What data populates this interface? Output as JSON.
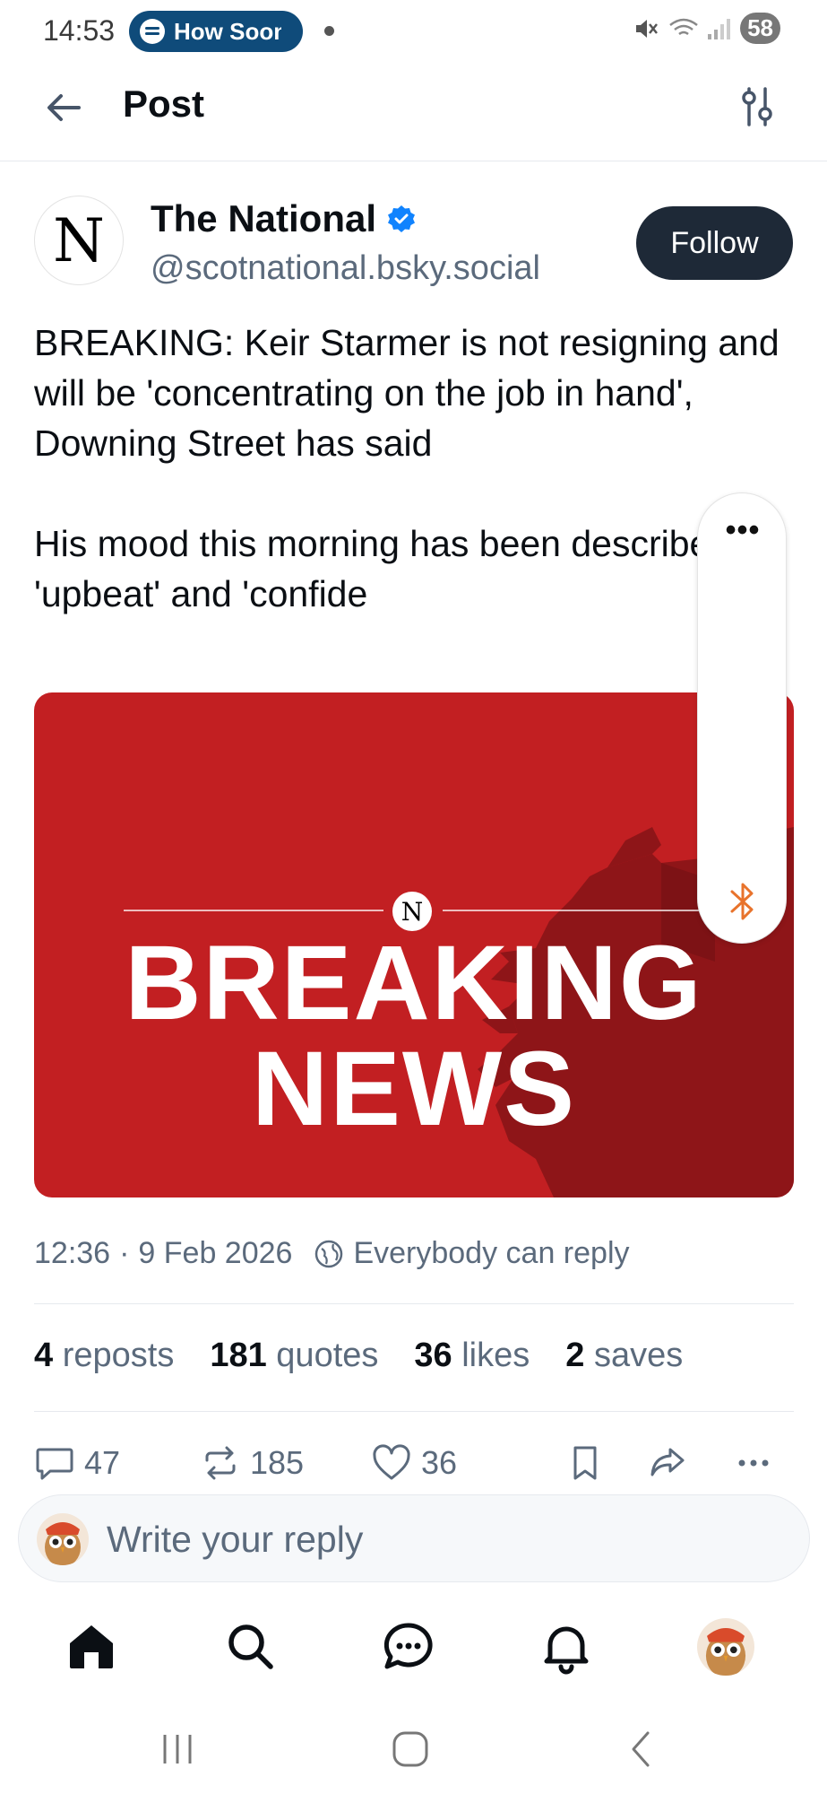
{
  "status_bar": {
    "time": "14:53",
    "now_playing": "How Soon",
    "battery": "58"
  },
  "header": {
    "title": "Post"
  },
  "post": {
    "author_name": "The National",
    "author_logo": "N",
    "handle": "@scotnational.bsky.social",
    "follow_label": "Follow",
    "body": "BREAKING: Keir Starmer is not resigning and will be 'concentrating on the job in hand', Downing Street has said\n\nHis mood this morning has been described as 'upbeat' and 'confide",
    "image": {
      "logo": "N",
      "line1": "BREAKING",
      "line2": "NEWS",
      "bg_color": "#c21f22"
    },
    "timestamp": "12:36",
    "date": "9 Feb 2026",
    "meta_sep": "·",
    "reply_setting": "Everybody can reply"
  },
  "stats": {
    "reposts_count": "4",
    "reposts_label": "reposts",
    "quotes_count": "181",
    "quotes_label": "quotes",
    "likes_count": "36",
    "likes_label": "likes",
    "saves_count": "2",
    "saves_label": "saves"
  },
  "actions": {
    "reply_count": "47",
    "repost_count": "185",
    "like_count": "36"
  },
  "side_panel": {
    "more_label": "•••"
  },
  "reply_box": {
    "placeholder": "Write your reply"
  },
  "colors": {
    "accent": "#1083fe",
    "follow_bg": "#1e2937",
    "muted_text": "#5b6a7c",
    "bluetooth": "#e8732c"
  },
  "icons": [
    "back-arrow-icon",
    "filter-icon",
    "verified-icon",
    "globe-icon",
    "reply-icon",
    "repost-icon",
    "heart-icon",
    "bookmark-icon",
    "share-icon",
    "more-icon",
    "home-icon",
    "search-icon",
    "chat-icon",
    "bell-icon",
    "bluetooth-icon"
  ]
}
